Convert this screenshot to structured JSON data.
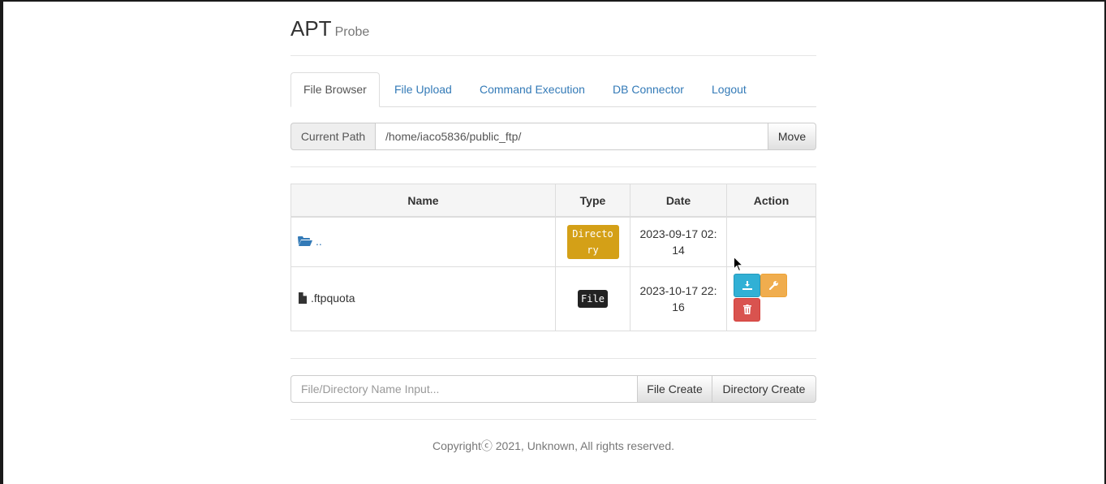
{
  "header": {
    "brand": "APT",
    "subtitle": "Probe"
  },
  "tabs": [
    {
      "label": "File Browser",
      "active": true
    },
    {
      "label": "File Upload"
    },
    {
      "label": "Command Execution"
    },
    {
      "label": "DB Connector"
    },
    {
      "label": "Logout"
    }
  ],
  "path_bar": {
    "addon_label": "Current Path",
    "value": "/home/iaco5836/public_ftp/",
    "move_label": "Move"
  },
  "table": {
    "columns": [
      "Name",
      "Type",
      "Date",
      "Action"
    ],
    "rows": [
      {
        "icon": "folder-open-icon",
        "name": "..",
        "type": "Directory",
        "date": "2023-09-17 02:14"
      },
      {
        "icon": "file-icon",
        "name": ".ftpquota",
        "type": "File",
        "date": "2023-10-17 22:16",
        "actions": [
          "download-icon",
          "wrench-icon",
          "trash-icon"
        ]
      }
    ]
  },
  "create": {
    "placeholder": "File/Directory Name Input...",
    "file_create_label": "File Create",
    "directory_create_label": "Directory Create"
  },
  "footer": {
    "copyright": "Copyrightⓒ 2021, Unknown, All rights reserved."
  },
  "colors": {
    "link": "#337ab7",
    "badge_directory": "#d4a017",
    "badge_file": "#222222",
    "btn_info": "#31b0d5",
    "btn_warning": "#f0ad4e",
    "btn_danger": "#d9534f"
  }
}
